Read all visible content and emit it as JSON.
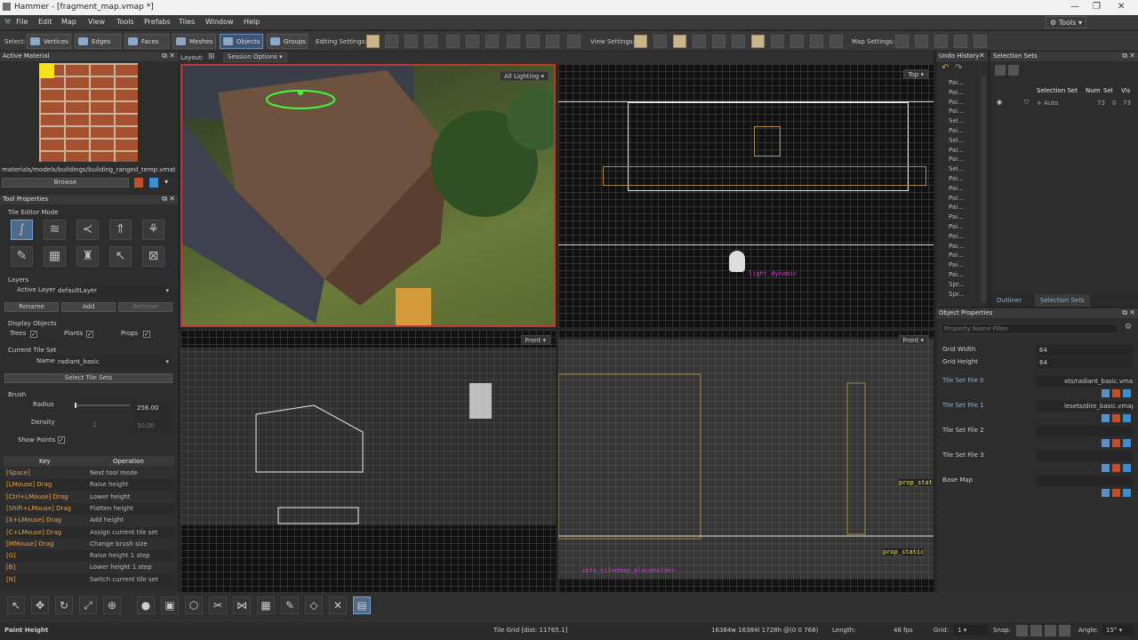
{
  "window": {
    "title": "Hammer - [fragment_map.vmap *]"
  },
  "menu": [
    "File",
    "Edit",
    "Map",
    "View",
    "Tools",
    "Prefabs",
    "Tiles",
    "Window",
    "Help"
  ],
  "menu_right": {
    "tools_label": "Tools"
  },
  "toolbar": {
    "select_label": "Select:",
    "select_modes": [
      "Vertices",
      "Edges",
      "Faces",
      "Meshes",
      "Objects",
      "Groups"
    ],
    "editing_settings_label": "Editing Settings:",
    "view_settings_label": "View Settings:",
    "map_settings_label": "Map Settings:"
  },
  "active_material": {
    "title": "Active Material",
    "path": "materials/models/buildings/building_ranged_temp.vmat",
    "browse_label": "Browse"
  },
  "tool_properties": {
    "title": "Tool Properties",
    "mode_label": "Tile Editor Mode",
    "layers_label": "Layers",
    "active_layer_label": "Active Layer",
    "active_layer_value": "defaultLayer",
    "rename_label": "Rename",
    "add_label": "Add",
    "remove_label": "Remove",
    "display_objects_label": "Display Objects",
    "trees_label": "Trees",
    "plants_label": "Plants",
    "props_label": "Props",
    "current_tile_set_label": "Current Tile Set",
    "name_label": "Name",
    "name_value": "radiant_basic",
    "select_tile_sets_label": "Select Tile Sets",
    "brush_label": "Brush",
    "radius_label": "Radius",
    "radius_value": "256.00",
    "density_label": "Density",
    "density_value": "50.00",
    "density_min": "1",
    "show_points_label": "Show Points"
  },
  "key_table": {
    "headers": [
      "Key",
      "Operation"
    ],
    "rows": [
      [
        "[Space]",
        "Next tool mode"
      ],
      [
        "[LMouse] Drag",
        "Raise height"
      ],
      [
        "[Ctrl+LMouse] Drag",
        "Lower height"
      ],
      [
        "[Shift+LMouse] Drag",
        "Flatten height"
      ],
      [
        "[X+LMouse] Drag",
        "Add height"
      ],
      [
        "[C+LMouse] Drag",
        "Assign current tile set"
      ],
      [
        "[MMouse] Drag",
        "Change brush size"
      ],
      [
        "[G]",
        "Raise height 1 step"
      ],
      [
        "[B]",
        "Lower height 1 step"
      ],
      [
        "[N]",
        "Switch current tile set"
      ]
    ]
  },
  "layout_bar": {
    "label": "Layout:",
    "session_options": "Session Options"
  },
  "viewports": {
    "perspective_mode": "All Lighting",
    "top_label": "Top",
    "front_left_label": "Front",
    "front_right_label": "Front",
    "light_label": "light_dynamic",
    "prop_static_1": "prop_static",
    "prop_static_2": "prop_static",
    "info_placeholder": "info_tiledmap_placeholder"
  },
  "undo_history": {
    "title": "Undo History",
    "items": [
      "Pai...",
      "Pai...",
      "Pai...",
      "Pai...",
      "Sel...",
      "Pai...",
      "Sel...",
      "Pai...",
      "Pai...",
      "Sel...",
      "Pai...",
      "Pai...",
      "Pai...",
      "Pai...",
      "Pai...",
      "Pai...",
      "Pai...",
      "Pai...",
      "Pai...",
      "Pai...",
      "Pai...",
      "Spr...",
      "Spr..."
    ]
  },
  "selection_sets": {
    "title": "Selection Sets",
    "headers": [
      "Selection Set",
      "Num",
      "Sel",
      "Vis"
    ],
    "row": {
      "name": "Auto",
      "num": "73",
      "sel": "0",
      "vis": "73"
    },
    "tabs": [
      "Outliner",
      "Selection Sets"
    ]
  },
  "object_properties": {
    "title": "Object Properties",
    "filter_placeholder": "Property Name Filter",
    "props": [
      {
        "name": "Grid Width",
        "value": "64"
      },
      {
        "name": "Grid Height",
        "value": "64"
      },
      {
        "name": "Tile Set File 0",
        "value": "xts/radiant_basic.vmap"
      },
      {
        "name": "Tile Set File 1",
        "value": "lesets/dire_basic.vmap"
      },
      {
        "name": "Tile Set File 2",
        "value": ""
      },
      {
        "name": "Tile Set File 3",
        "value": ""
      },
      {
        "name": "Base Map",
        "value": ""
      }
    ]
  },
  "status": {
    "mode": "Paint Height",
    "tile_grid": "Tile Grid   [dist: 11765.1]",
    "coords": "16384w 16384l 1728h @(0 0 768)",
    "length_label": "Length:",
    "fps": "46 fps",
    "grid_label": "Grid:",
    "grid_value": "1",
    "snap_label": "Snap:",
    "angle_label": "Angle:",
    "angle_value": "15°"
  },
  "colors": {
    "accent": "#6a8fb8",
    "key_orange": "#e8a14a",
    "viewport_border": "#c0392b"
  }
}
